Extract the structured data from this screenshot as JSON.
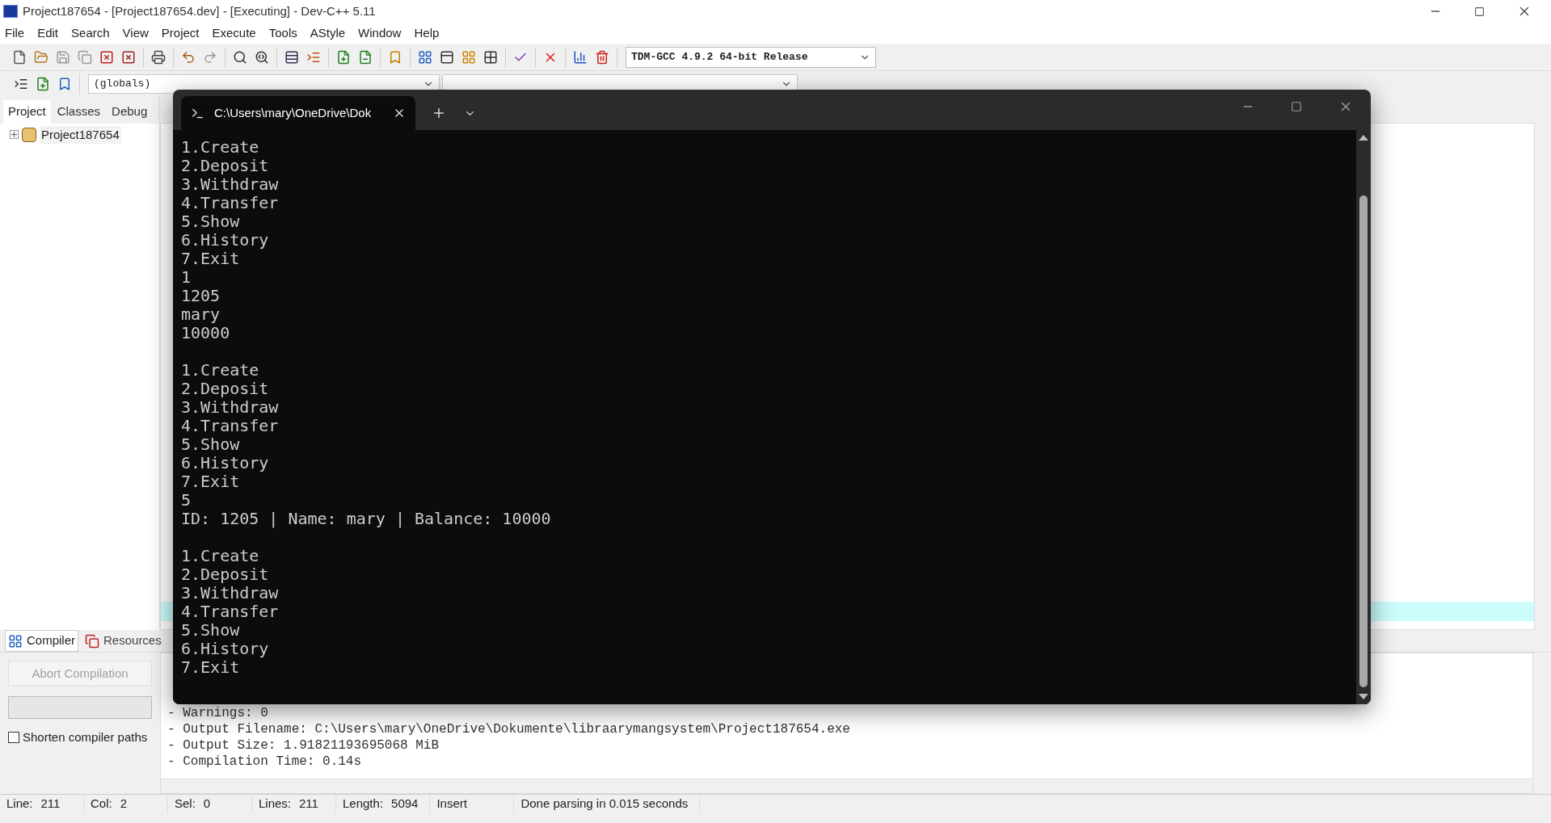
{
  "window": {
    "title": "Project187654 - [Project187654.dev] - [Executing] - Dev-C++ 5.11"
  },
  "menu": [
    "File",
    "Edit",
    "Search",
    "View",
    "Project",
    "Execute",
    "Tools",
    "AStyle",
    "Window",
    "Help"
  ],
  "compiler_select": {
    "value": "TDM-GCC 4.9.2 64-bit Release"
  },
  "scope_select": {
    "value": "(globals)"
  },
  "left_tabs": [
    {
      "label": "Project",
      "selected": true
    },
    {
      "label": "Classes",
      "selected": false
    },
    {
      "label": "Debug",
      "selected": false
    }
  ],
  "project_tree": [
    {
      "label": "Project187654",
      "expanded": false
    }
  ],
  "bottom_tabs": [
    {
      "label": "Compiler",
      "selected": true
    },
    {
      "label": "Resources",
      "selected": false
    }
  ],
  "abort_button": {
    "label": "Abort Compilation",
    "disabled": true
  },
  "progress": {
    "level": 0
  },
  "shorten_paths": {
    "label": "Shorten compiler paths",
    "checked": false
  },
  "compiler_log": [
    "- Warnings: 0",
    "- Output Filename: C:\\Users\\mary\\OneDrive\\Dokumente\\libraarymangsystem\\Project187654.exe",
    "- Output Size: 1.91821193695068 MiB",
    "- Compilation Time: 0.14s"
  ],
  "status_bar": [
    {
      "label": "Line:",
      "value": "211"
    },
    {
      "label": "Col:",
      "value": "2"
    },
    {
      "label": "Sel:",
      "value": "0"
    },
    {
      "label": "Lines:",
      "value": "211"
    },
    {
      "label": "Length:",
      "value": "5094"
    },
    {
      "value": "Insert"
    },
    {
      "value": "Done parsing in 0.015 seconds"
    }
  ],
  "terminal": {
    "tab_title": "C:\\Users\\mary\\OneDrive\\Dok",
    "blocks": [
      [
        "1.Create",
        "2.Deposit",
        "3.Withdraw",
        "4.Transfer",
        "5.Show",
        "6.History",
        "7.Exit",
        "1",
        "1205",
        "mary",
        "10000"
      ],
      [
        "1.Create",
        "2.Deposit",
        "3.Withdraw",
        "4.Transfer",
        "5.Show",
        "6.History",
        "7.Exit",
        "5",
        "ID: 1205 | Name: mary | Balance: 10000"
      ],
      [
        "1.Create",
        "2.Deposit",
        "3.Withdraw",
        "4.Transfer",
        "5.Show",
        "6.History",
        "7.Exit"
      ]
    ]
  }
}
